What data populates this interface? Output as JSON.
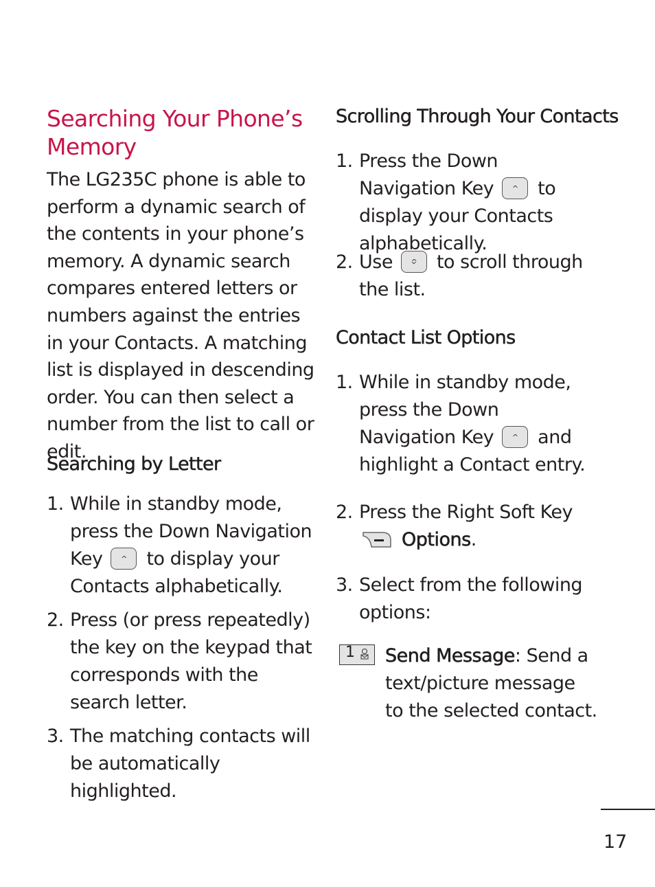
{
  "left": {
    "title_line1": "Searching Your Phone’s",
    "title_line2": "Memory",
    "intro": "The LG235C phone is able to perform a dynamic search of the contents in your phone’s memory. A dynamic search compares entered letters or numbers against the entries in your Contacts. A matching list is displayed in descending order. You can then select a number from the list to call or edit.",
    "subhead": "Searching by Letter",
    "steps": [
      {
        "num": "1.",
        "pre": "While in standby mode, press the Down Navigation Key",
        "post": "to display your Contacts alphabetically.",
        "icon": "down-navigation-key-icon"
      },
      {
        "num": "2.",
        "text": "Press (or press repeatedly) the key on the keypad that corresponds with the search letter."
      },
      {
        "num": "3.",
        "text": "The matching contacts will be automatically highlighted."
      }
    ]
  },
  "right": {
    "subhead1": "Scrolling Through Your Contacts",
    "scroll_steps": [
      {
        "num": "1.",
        "pre": "Press the Down Navigation Key",
        "post": "to display your Contacts alphabetically.",
        "icon": "down-navigation-key-icon"
      },
      {
        "num": "2.",
        "pre": "Use",
        "post": "to scroll through the list.",
        "icon": "up-down-navigation-key-icon"
      }
    ],
    "subhead2": "Contact List Options",
    "option_steps": [
      {
        "num": "1.",
        "pre": "While in standby mode, press the Down Navigation Key",
        "post": "and highlight a Contact entry.",
        "icon": "down-navigation-key-icon"
      },
      {
        "num": "2.",
        "pre": "Press the Right Soft Key",
        "bold": "Options",
        "post": ".",
        "icon": "right-soft-key-icon"
      },
      {
        "num": "3.",
        "text": "Select from the following options:"
      }
    ],
    "option_items": [
      {
        "key": "1",
        "icon": "message-key-icon",
        "label": "Send Message",
        "desc": ": Send a text/picture message to the selected contact."
      }
    ]
  },
  "page_number": "17",
  "colors": {
    "title": "#c8144b",
    "text": "#231f20",
    "key_fill": "#e4e4e4"
  }
}
